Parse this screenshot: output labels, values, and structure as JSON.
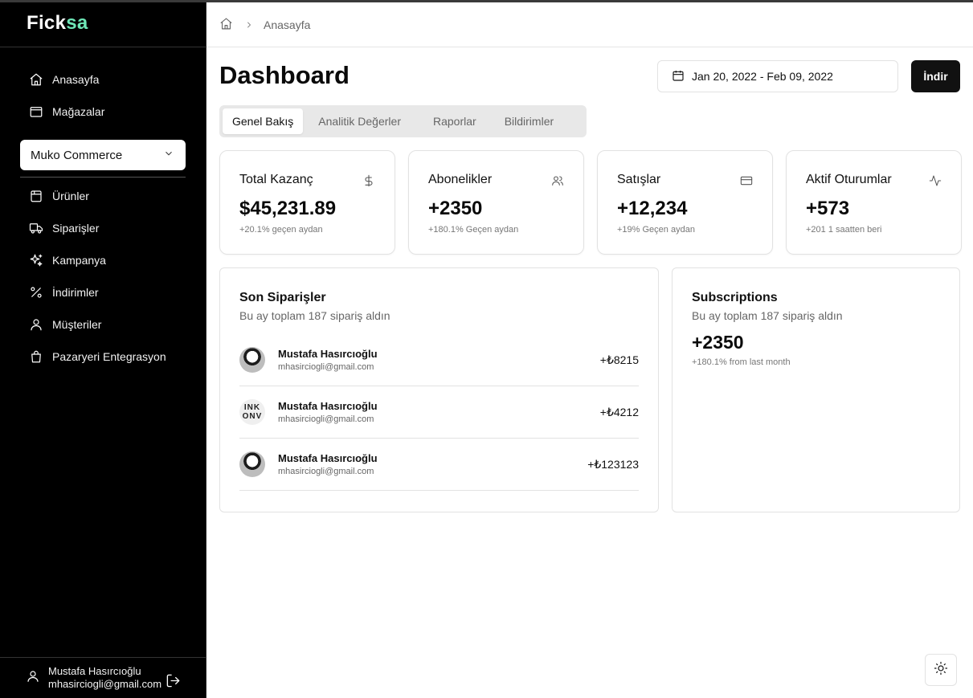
{
  "brand": {
    "name_main": "Fick",
    "name_accent": "sa",
    "accent_color": "#6ee7b7"
  },
  "sidebar": {
    "top_items": [
      {
        "label": "Anasayfa",
        "icon": "home-icon"
      },
      {
        "label": "Mağazalar",
        "icon": "store-icon"
      }
    ],
    "store_select": {
      "value": "Muko Commerce",
      "icon": "chevron-down-icon"
    },
    "items": [
      {
        "label": "Ürünler",
        "icon": "package-icon"
      },
      {
        "label": "Siparişler",
        "icon": "truck-icon"
      },
      {
        "label": "Kampanya",
        "icon": "sparkles-icon"
      },
      {
        "label": "İndirimler",
        "icon": "percent-icon"
      },
      {
        "label": "Müşteriler",
        "icon": "user-icon"
      },
      {
        "label": "Pazaryeri Entegrasyon",
        "icon": "shopping-bag-icon"
      }
    ],
    "user": {
      "name": "Mustafa Hasırcıoğlu",
      "email": "mhasirciogli@gmail.com"
    }
  },
  "breadcrumb": {
    "current": "Anasayfa"
  },
  "header": {
    "title": "Dashboard",
    "date_range": "Jan 20, 2022 - Feb 09, 2022",
    "download_label": "İndir"
  },
  "tabs": [
    "Genel Bakış",
    "Analitik Değerler",
    "Raporlar",
    "Bildirimler"
  ],
  "stats": [
    {
      "title": "Total Kazanç",
      "value": "$45,231.89",
      "sub": "+20.1% geçen aydan",
      "icon": "dollar-icon"
    },
    {
      "title": "Abonelikler",
      "value": "+2350",
      "sub": "+180.1% Geçen aydan",
      "icon": "users-icon"
    },
    {
      "title": "Satışlar",
      "value": "+12,234",
      "sub": "+19% Geçen aydan",
      "icon": "credit-card-icon"
    },
    {
      "title": "Aktif Oturumlar",
      "value": "+573",
      "sub": "+201 1 saatten beri",
      "icon": "activity-icon"
    }
  ],
  "orders": {
    "title": "Son Siparişler",
    "description": "Bu ay toplam 187 sipariş aldın",
    "rows": [
      {
        "name": "Mustafa Hasırcıoğlu",
        "email": "mhasirciogli@gmail.com",
        "amount": "+₺8215"
      },
      {
        "name": "Mustafa Hasırcıoğlu",
        "email": "mhasirciogli@gmail.com",
        "amount": "+₺4212"
      },
      {
        "name": "Mustafa Hasırcıoğlu",
        "email": "mhasirciogli@gmail.com",
        "amount": "+₺123123"
      }
    ]
  },
  "subscriptions": {
    "title": "Subscriptions",
    "description": "Bu ay toplam 187 sipariş aldın",
    "value": "+2350",
    "sub": "+180.1% from last month"
  }
}
